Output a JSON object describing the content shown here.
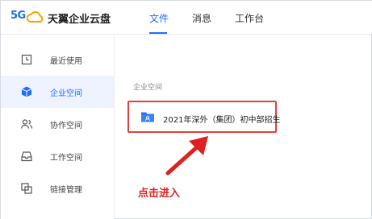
{
  "header": {
    "logo_5g": "5G",
    "brand": "天翼企业云盘",
    "nav": [
      {
        "label": "文件",
        "active": true
      },
      {
        "label": "消息",
        "active": false
      },
      {
        "label": "工作台",
        "active": false
      }
    ]
  },
  "sidebar": {
    "items": [
      {
        "label": "最近使用",
        "icon": "recent-icon",
        "active": false
      },
      {
        "label": "企业空间",
        "icon": "cube-icon",
        "active": true
      },
      {
        "label": "协作空间",
        "icon": "collaboration-icon",
        "active": false
      },
      {
        "label": "工作空间",
        "icon": "workspace-icon",
        "active": false
      },
      {
        "label": "链接管理",
        "icon": "link-icon",
        "active": false
      }
    ]
  },
  "main": {
    "section_title": "企业空间",
    "folder": {
      "name": "2021年深外（集团）初中部招生",
      "icon": "folder-icon"
    },
    "annotation": {
      "text": "点击进入",
      "color": "#e02020"
    }
  },
  "colors": {
    "accent": "#1f6fff",
    "highlight": "#e04040"
  }
}
